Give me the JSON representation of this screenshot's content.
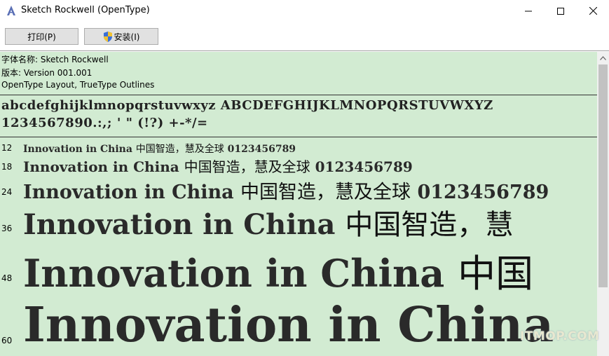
{
  "window": {
    "title": "Sketch Rockwell (OpenType)",
    "icons": [
      "app-font-icon",
      "minimize-icon",
      "maximize-icon",
      "close-icon"
    ]
  },
  "toolbar": {
    "print_label": "打印(P)",
    "install_label": "安装(I)",
    "install_icon": "shield-icon"
  },
  "info": {
    "font_name": "字体名称: Sketch Rockwell",
    "version": "版本: Version 001.001",
    "outline": "OpenType Layout, TrueType Outlines"
  },
  "charset": {
    "line1": "abcdefghijklmnopqrstuvwxyz ABCDEFGHIJKLMNOPQRSTUVWXYZ",
    "line2": "1234567890.:,; ' \" (!?) +-*/="
  },
  "samples": [
    {
      "size": "12",
      "latin": "Innovation in China",
      "cjk": "中国智造，慧及全球",
      "digits": "0123456789"
    },
    {
      "size": "18",
      "latin": "Innovation in China",
      "cjk": "中国智造，慧及全球",
      "digits": "0123456789"
    },
    {
      "size": "24",
      "latin": "Innovation in China",
      "cjk": "中国智造，慧及全球",
      "digits": "0123456789"
    },
    {
      "size": "36",
      "latin": "Innovation in China",
      "cjk": "中国智造，慧",
      "digits": ""
    },
    {
      "size": "48",
      "latin": "Innovation in China",
      "cjk": "中国",
      "digits": ""
    },
    {
      "size": "60",
      "latin": "Innovation in China",
      "cjk": "",
      "digits": ""
    }
  ],
  "watermark": "ITMOP.COM",
  "colors": {
    "content_bg": "#d2ebd2",
    "scroll_thumb": "#c2c2c2"
  }
}
